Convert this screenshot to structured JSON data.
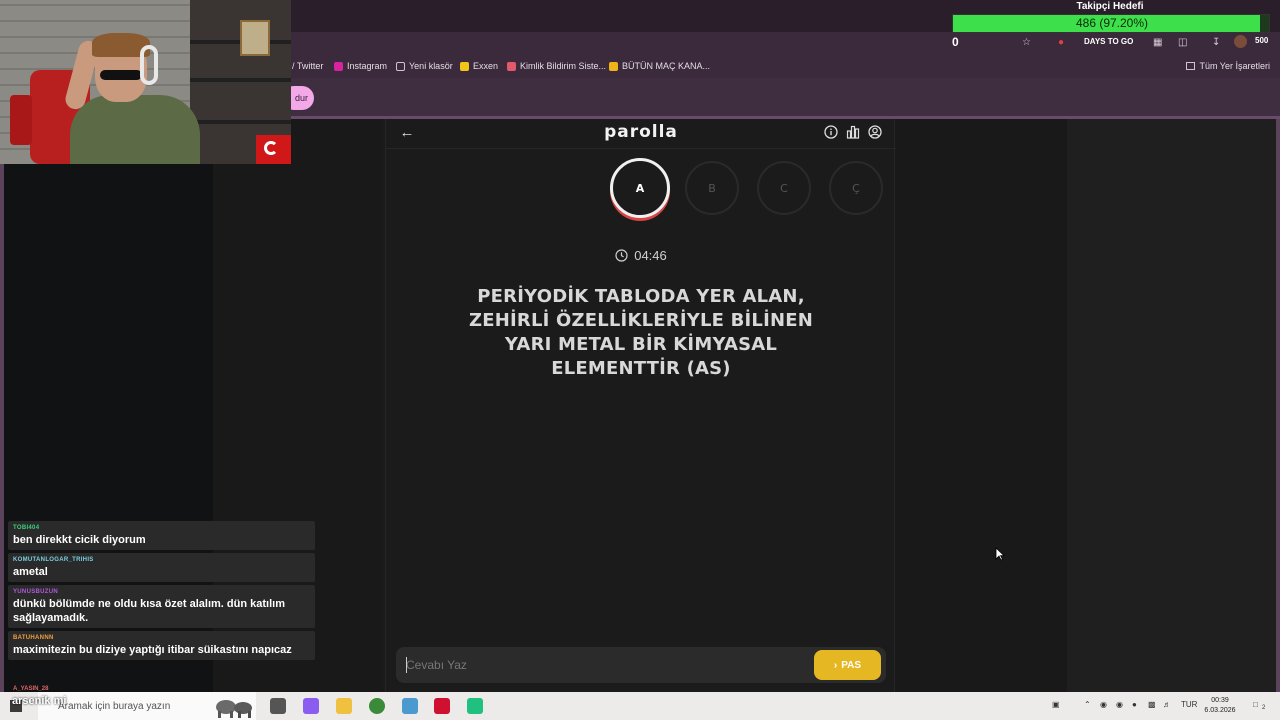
{
  "overlay": {
    "goal_title": "Takipçi Hedefi",
    "goal_text": "486 (97.20%)",
    "goal_fraction": 0.972,
    "goal_zero": "0"
  },
  "toolbar": {
    "days_to_go": "DAYS TO GO",
    "badge_count": "500"
  },
  "bookmarks": [
    {
      "label": "/ Twitter",
      "color": "#2a2a2a"
    },
    {
      "label": "Instagram",
      "color": "#d6249f"
    },
    {
      "label": "Yeni klasör",
      "color": "#cfc3cf"
    },
    {
      "label": "Exxen",
      "color": "#f0c419"
    },
    {
      "label": "Kimlik Bildirim Siste...",
      "color": "#e05a6a"
    },
    {
      "label": "BÜTÜN MAÇ KANA...",
      "color": "#f0b419"
    }
  ],
  "bookmarks_right": "Tüm Yer İşaretleri",
  "strip_pill": "dur",
  "game": {
    "logo": "parolla",
    "letters": [
      "A",
      "B",
      "C",
      "Ç"
    ],
    "timer": "04:46",
    "question": "PERİYODİK TABLODA YER ALAN, ZEHİRLİ ÖZELLİKLERİYLE BİLİNEN YARI METAL BİR KİMYASAL ELEMENTTİR (AS)",
    "answer_placeholder": "Cevabı Yaz",
    "pass_label": "PAS",
    "accent": "#e5b823",
    "active_ring": "#d84545"
  },
  "chat": [
    {
      "user": "TOBI404",
      "color": "#3ad17a",
      "text": "ben direkkt cicik diyorum"
    },
    {
      "user": "KOMUTANLOGAR_TRIHIS",
      "color": "#7ad0e0",
      "text": "ametal"
    },
    {
      "user": "YUNUSBUZUN",
      "color": "#b05ae0",
      "text": "dünkü bölümde ne oldu kısa özet alalım. dün katılım sağlayamadık."
    },
    {
      "user": "BATUHANNN",
      "color": "#f0a040",
      "text": "maximitezin bu diziye yaptığı itibar süikastını napıcaz"
    }
  ],
  "chat_partial_user": "A_YASIN_28",
  "taskbar": {
    "overlay_line": "arsenik mi",
    "search_placeholder": "Aramak için buraya yazın",
    "lang": "TUR",
    "time": "00:39",
    "date": "6.03.2026",
    "notif_count": "2"
  }
}
